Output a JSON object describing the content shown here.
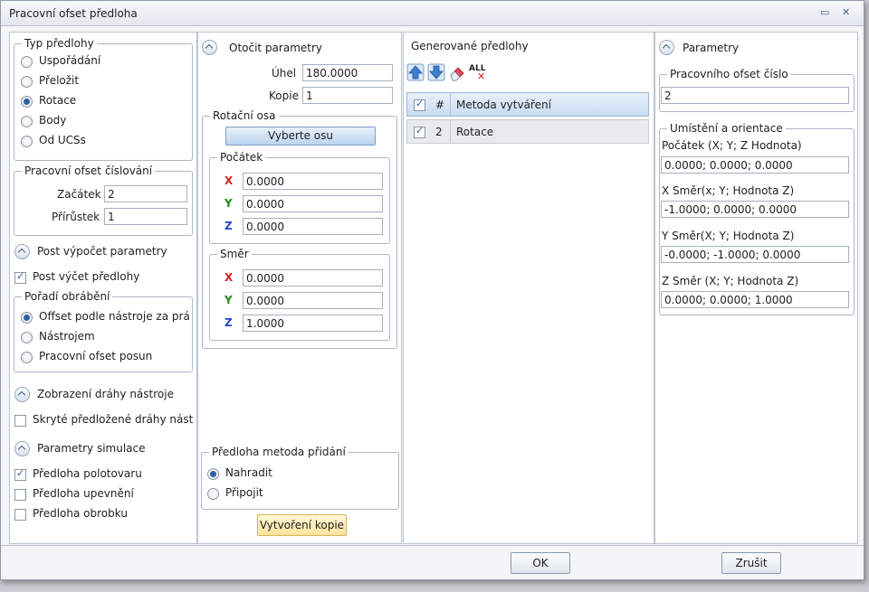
{
  "window": {
    "title": "Pracovní ofset předloha"
  },
  "template_type": {
    "legend": "Typ předlohy",
    "options": [
      "Uspořádání",
      "Přeložit",
      "Rotace",
      "Body",
      "Od UCSs"
    ],
    "selected": "Rotace"
  },
  "numbering": {
    "legend": "Pracovní ofset číslování",
    "start_label": "Začátek",
    "start_value": "2",
    "step_label": "Přírůstek",
    "step_value": "1"
  },
  "post": {
    "section": "Post výpočet parametry",
    "checkbox": "Post výčet předlohy",
    "checked": true
  },
  "machining_order": {
    "legend": "Pořadí obrábění",
    "options": [
      "Offset podle nástroje za prá",
      "Nástrojem",
      "Pracovní ofset posun"
    ],
    "selected": "Offset podle nástroje za prá"
  },
  "toolpath_display": {
    "section": "Zobrazení dráhy nástroje",
    "checkbox": "Skryté předložené dráhy nástr",
    "checked": false
  },
  "simulation": {
    "section": "Parametry simulace",
    "items": [
      {
        "label": "Předloha polotovaru",
        "checked": true
      },
      {
        "label": "Předloha upevnění",
        "checked": false
      },
      {
        "label": "Předloha obrobku",
        "checked": false
      }
    ]
  },
  "rotate": {
    "section": "Otočit parametry",
    "angle_label": "Úhel",
    "angle_value": "180.0000",
    "copies_label": "Kopie",
    "copies_value": "1",
    "axis_legend": "Rotační osa",
    "select_axis_button": "Vyberte osu",
    "origin_legend": "Počátek",
    "origin": {
      "x": "0.0000",
      "y": "0.0000",
      "z": "0.0000"
    },
    "direction_legend": "Směr",
    "direction": {
      "x": "0.0000",
      "y": "0.0000",
      "z": "1.0000"
    },
    "axis_labels": {
      "x": "X",
      "y": "Y",
      "z": "Z"
    },
    "axis_colors": {
      "x": "#d42020",
      "y": "#1a8f1a",
      "z": "#2244cc"
    }
  },
  "add_method": {
    "legend": "Předloha metoda přidání",
    "options": [
      "Nahradit",
      "Připojit"
    ],
    "selected": "Nahradit"
  },
  "create_copy_button": "Vytvoření kopie",
  "generated": {
    "title": "Generované předlohy",
    "toolbar_icons": [
      "arrow-up-icon",
      "arrow-down-icon",
      "eraser-icon",
      "delete-all-icon"
    ],
    "delete_all_text": "ALL",
    "columns": [
      "#",
      "Metoda vytváření"
    ],
    "rows": [
      {
        "checked": true,
        "num": "2",
        "method": "Rotace"
      }
    ]
  },
  "params": {
    "section": "Parametry",
    "wo_number_legend": "Pracovního ofset číslo",
    "wo_number_value": "2",
    "placement_legend": "Umístění a orientace",
    "origin_label": "Počátek (X; Y; Z Hodnota)",
    "origin_value": "0.0000; 0.0000; 0.0000",
    "xdir_label": "X Směr(x; Y; Hodnota Z)",
    "xdir_value": "-1.0000; 0.0000; 0.0000",
    "ydir_label": "Y Směr(X; Y; Hodnota Z)",
    "ydir_value": "-0.0000; -1.0000; 0.0000",
    "zdir_label": "Z Směr (X; Y; Hodnota Z)",
    "zdir_value": "0.0000; 0.0000; 1.0000"
  },
  "footer": {
    "ok": "OK",
    "cancel": "Zrušit"
  },
  "colors": {
    "accent": "#2c5fa6",
    "grid_header": "#d7e6f7"
  }
}
